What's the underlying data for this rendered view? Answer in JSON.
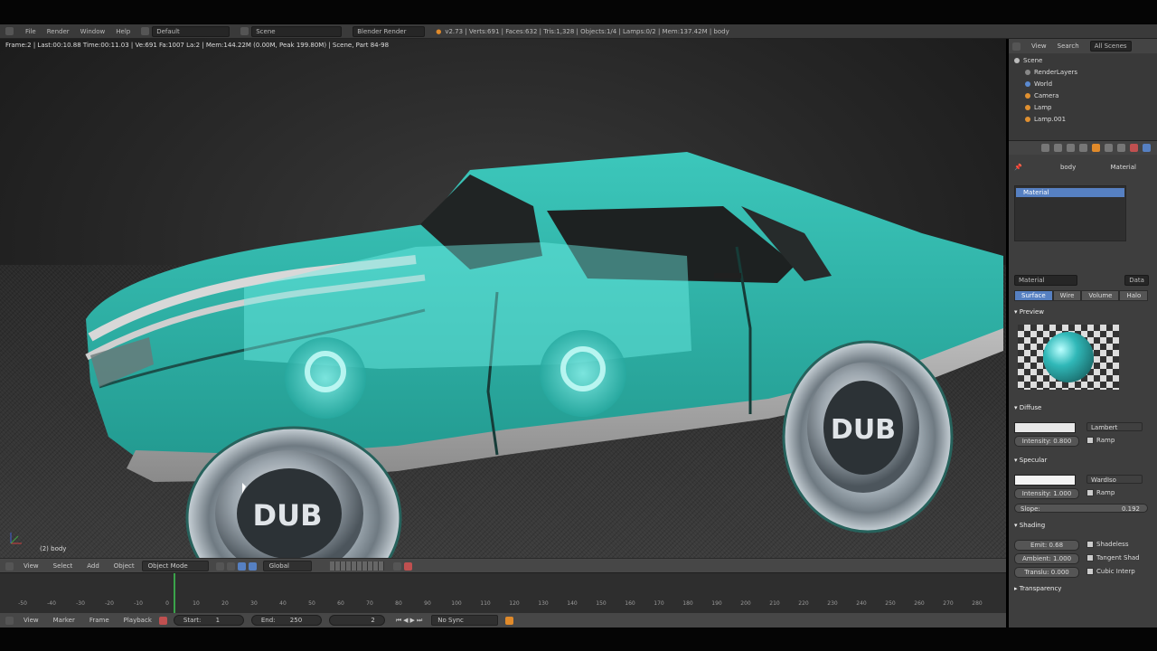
{
  "info_header": {
    "menus": [
      "File",
      "Render",
      "Window",
      "Help"
    ],
    "layout": "Default",
    "scene": "Scene",
    "engine": "Blender Render",
    "stats": "v2.73 | Verts:691 | Faces:632 | Tris:1,328 | Objects:1/4 | Lamps:0/2 | Mem:137.42M | body"
  },
  "viewport": {
    "render_stats": "Frame:2 | Last:00:10.88 Time:00:11.03 | Ve:691 Fa:1007 La:2 | Mem:144.22M (0.00M, Peak 199.80M) | Scene, Part 84-98",
    "object_name": "(2) body",
    "wheel_logo": "DUB",
    "body_color": "#2fb3a8"
  },
  "view3d_header": {
    "menus": [
      "View",
      "Select",
      "Add",
      "Object"
    ],
    "mode": "Object Mode",
    "orientation": "Global"
  },
  "timeline": {
    "ticks": [
      "-50",
      "-40",
      "-30",
      "-20",
      "-10",
      "0",
      "10",
      "20",
      "30",
      "40",
      "50",
      "60",
      "70",
      "80",
      "90",
      "100",
      "110",
      "120",
      "130",
      "140",
      "150",
      "160",
      "170",
      "180",
      "190",
      "200",
      "210",
      "220",
      "230",
      "240",
      "250",
      "260",
      "270",
      "280"
    ],
    "menus": [
      "View",
      "Marker",
      "Frame",
      "Playback"
    ],
    "start_label": "Start:",
    "start_value": "1",
    "end_label": "End:",
    "end_value": "250",
    "current_frame": "2",
    "sync": "No Sync"
  },
  "outliner": {
    "header_items": [
      "View",
      "Search",
      "All Scenes"
    ],
    "rows": [
      "Scene",
      "RenderLayers",
      "World",
      "Camera",
      "Lamp",
      "Lamp.001"
    ]
  },
  "properties": {
    "breadcrumb_object": "body",
    "breadcrumb_material": "Material",
    "material_slot": "Material",
    "datablock_name": "Material",
    "data_label": "Data",
    "tabs": [
      "Surface",
      "Wire",
      "Volume",
      "Halo"
    ],
    "preview_label": "Preview",
    "diffuse_label": "Diffuse",
    "diffuse_shader": "Lambert",
    "diffuse_intensity": "Intensity: 0.800",
    "ramp_label": "Ramp",
    "specular_label": "Specular",
    "specular_shader": "WardIso",
    "specular_intensity": "Intensity: 1.000",
    "slope_label": "Slope:",
    "slope_value": "0.192",
    "shading_label": "Shading",
    "emit": "Emit: 0.68",
    "ambient": "Ambient: 1.000",
    "translucency": "Translu: 0.000",
    "shadeless": "Shadeless",
    "tangent": "Tangent Shad",
    "cubic": "Cubic Interp",
    "transparency_label": "Transparency"
  }
}
